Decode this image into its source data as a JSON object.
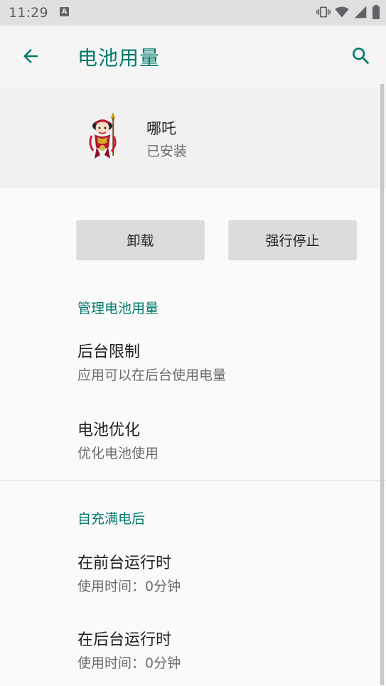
{
  "status_bar": {
    "time": "11:29",
    "left_badge": "A",
    "icons": [
      "vibrate-icon",
      "wifi-icon",
      "signal-icon",
      "battery-icon"
    ]
  },
  "app_bar": {
    "title": "电池用量",
    "back_icon": "back-arrow-icon",
    "search_icon": "search-icon",
    "accent_color": "#00796b"
  },
  "app_info": {
    "name": "哪吒",
    "status": "已安装"
  },
  "buttons": {
    "uninstall": "卸载",
    "force_stop": "强行停止"
  },
  "sections": {
    "manage": "管理电池用量",
    "since_full_charge": "自充满电后"
  },
  "preferences": [
    {
      "title": "后台限制",
      "summary": "应用可以在后台使用电量"
    },
    {
      "title": "电池优化",
      "summary": "优化电池使用"
    },
    {
      "title": "在前台运行时",
      "summary": "使用时间：0分钟"
    },
    {
      "title": "在后台运行时",
      "summary": "使用时间：0分钟"
    }
  ]
}
